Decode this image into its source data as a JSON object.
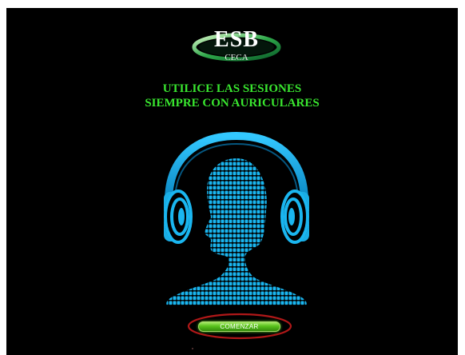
{
  "logo": {
    "main_text": "ESB",
    "sub_text": "CECA"
  },
  "headline": {
    "line1": "UTILICE LAS SESIONES",
    "line2": "SIEMPRE CON AURICULARES"
  },
  "illustration": {
    "icon": "headphones-head-icon",
    "color": "#1ab6f0"
  },
  "start_button": {
    "label": "COMENZAR",
    "highlight_ring_color": "#b01818"
  },
  "colors": {
    "background": "#000000",
    "headline": "#39e62f",
    "button": "#59c21c"
  }
}
